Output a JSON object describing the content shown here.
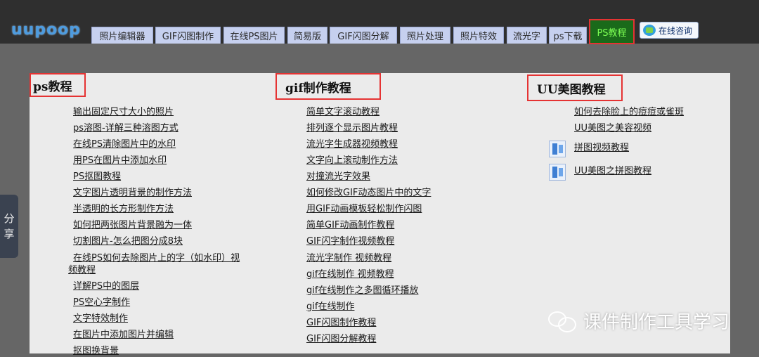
{
  "header": {
    "logo": "uupoop",
    "tabs": [
      {
        "label": "照片编辑器"
      },
      {
        "label": "GIF闪图制作"
      },
      {
        "label": "在线PS图片"
      },
      {
        "label": "简易版"
      },
      {
        "label": "GIF闪图分解"
      },
      {
        "label": "照片处理"
      },
      {
        "label": "照片特效"
      },
      {
        "label": "流光字"
      },
      {
        "label": "ps下载"
      },
      {
        "label": "PS教程"
      }
    ],
    "consult": "在线咨询"
  },
  "share": [
    "分",
    "享"
  ],
  "columns": [
    {
      "title": "ps教程",
      "links": [
        "输出固定尺寸大小的照片",
        "ps溶图-详解三种溶图方式",
        "在线PS清除图片中的水印",
        "用PS在图片中添加水印",
        "PS抠图教程",
        "文字图片透明背景的制作方法",
        "半透明的长方形制作方法",
        "如何把两张图片背景融为一体",
        "切割图片-怎么把图分成8块",
        "在线PS如何去除图片上的字（如水印）视",
        "频教程",
        "详解PS中的图层",
        "PS空心字制作",
        "文字特效制作",
        "在图片中添加图片并编辑",
        "抠图换背景"
      ]
    },
    {
      "title": "gif制作教程",
      "links": [
        "简单文字滚动教程",
        "排列逐个显示图片教程",
        "流光字生成器视频教程",
        "文字向上滚动制作方法",
        "对撞流光字效果",
        "如何修改GIF动态图片中的文字",
        "用GIF动画模板轻松制作闪图",
        "简单GIF动画制作教程",
        "GIF闪字制作视频教程",
        "流光字制作 视频教程",
        "gif在线制作 视频教程",
        "gif在线制作之多图循环播放",
        "gif在线制作",
        "GIF闪图制作教程",
        "GIF闪图分解教程"
      ]
    },
    {
      "title": "UU美图教程",
      "links": [
        "如何去除脸上的痘痘或雀斑",
        "UU美图之美容视频",
        "拼图视频教程",
        "UU美图之拼图教程"
      ]
    }
  ],
  "watermark": "课件制作工具学习"
}
